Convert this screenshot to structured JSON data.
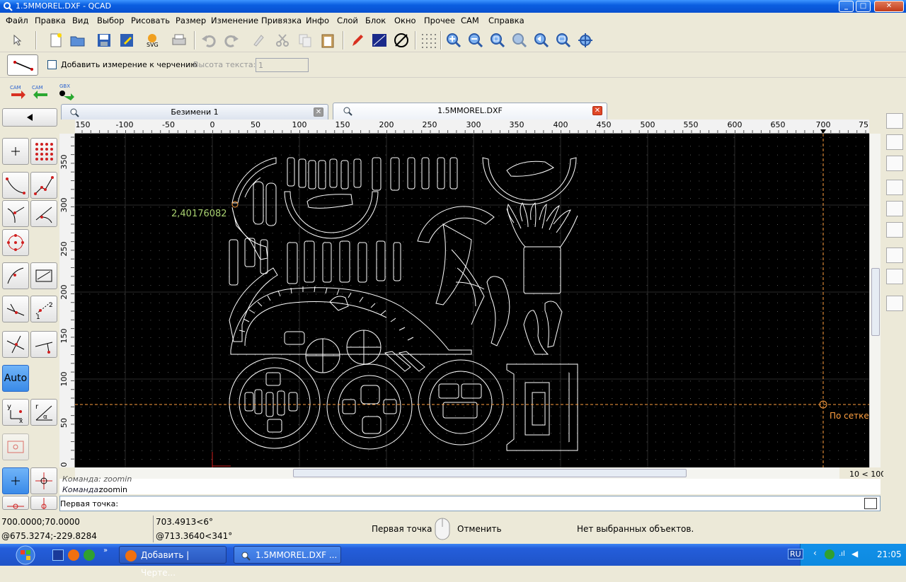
{
  "window": {
    "title": "1.5MMOREL.DXF - QCAD"
  },
  "menu": [
    "Файл",
    "Правка",
    "Вид",
    "Выбор",
    "Рисовать",
    "Размер",
    "Изменение",
    "Привязка",
    "Инфо",
    "Слой",
    "Блок",
    "Окно",
    "Прочее",
    "CAM",
    "Справка"
  ],
  "options": {
    "add_dimension_label": "Добавить измерение к черчению",
    "add_dimension_checked": false,
    "text_height_label": "Высота текста:",
    "text_height_value": "1"
  },
  "cam_toolbar": {
    "cam_label": "CAM",
    "gbx_label": "GBX"
  },
  "tabs": [
    {
      "label": "Безимени 1",
      "active": false
    },
    {
      "label": "1.5MMOREL.DXF",
      "active": true
    }
  ],
  "left_panel": {
    "auto_label": "Auto"
  },
  "ruler_h": [
    "150",
    "-100",
    "-50",
    "0",
    "50",
    "100",
    "150",
    "200",
    "250",
    "300",
    "350",
    "400",
    "450",
    "500",
    "550",
    "600",
    "650",
    "700",
    "75"
  ],
  "ruler_v": [
    "350",
    "300",
    "250",
    "200",
    "150",
    "100",
    "50",
    "0"
  ],
  "canvas": {
    "measure_text": "2,40176082",
    "snap_label": "По сетке"
  },
  "grid_info": "10 < 100",
  "command_history": {
    "prev": "Команда: zoomin",
    "last_prefix": "Команда:",
    "last_value": "zoomin"
  },
  "command_prompt": "Первая точка:",
  "status": {
    "abs_coord": "700.0000;70.0000",
    "rel_coord": "@675.3274;-229.8284",
    "polar": "703.4913<6°",
    "rel_polar": "@713.3640<341°",
    "left_mouse": "Первая точка",
    "right_mouse": "Отменить",
    "selection": "Нет выбранных объектов."
  },
  "taskbar": {
    "tasks": [
      "Добавить | Черте...",
      "1.5MMOREL.DXF ..."
    ],
    "lang": "RU",
    "clock": "21:05"
  },
  "colors": {
    "canvas_bg": "#000000",
    "drawing": "#ffffff",
    "snap": "#ffa040",
    "measure": "#a8d070"
  }
}
